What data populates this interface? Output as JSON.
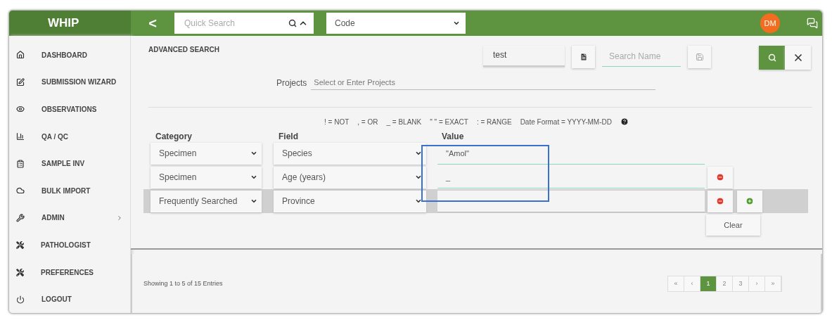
{
  "header": {
    "logo": "WHIP",
    "back": "<",
    "quick_search": {
      "placeholder": "Quick Search"
    },
    "code_select": {
      "value": "Code"
    },
    "avatar": "DM"
  },
  "sidebar": {
    "items": [
      {
        "label": "DASHBOARD",
        "kind": "home",
        "submenu": false
      },
      {
        "label": "SUBMISSION WIZARD",
        "kind": "edit",
        "submenu": false
      },
      {
        "label": "OBSERVATIONS",
        "kind": "eye",
        "submenu": false
      },
      {
        "label": "QA / QC",
        "kind": "chart",
        "submenu": false
      },
      {
        "label": "SAMPLE INV",
        "kind": "clipboard",
        "submenu": false
      },
      {
        "label": "BULK IMPORT",
        "kind": "cloud",
        "submenu": false
      },
      {
        "label": "ADMIN",
        "kind": "wrench",
        "submenu": true
      },
      {
        "label": "PATHOLOGIST",
        "kind": "tools",
        "submenu": false
      },
      {
        "label": "PREFERENCES",
        "kind": "tools",
        "submenu": false
      },
      {
        "label": "LOGOUT",
        "kind": "power",
        "submenu": false
      }
    ]
  },
  "search": {
    "title": "ADVANCED SEARCH",
    "saved_search": {
      "value": "test"
    },
    "search_name": {
      "placeholder": "Search Name"
    },
    "projects": {
      "label": "Projects",
      "placeholder": "Select or Enter Projects"
    },
    "hints": [
      "! = NOT",
      ", = OR",
      "_ = BLANK",
      "\" \" = EXACT",
      ": = RANGE",
      "Date Format = YYYY-MM-DD"
    ],
    "columns": [
      "Category",
      "Field",
      "Value"
    ],
    "rows": [
      {
        "category": "Specimen",
        "field": "Species",
        "value": "\"Amol\"",
        "removable": false,
        "addable": false,
        "highlighted": false
      },
      {
        "category": "Specimen",
        "field": "Age (years)",
        "value": "_",
        "removable": true,
        "addable": false,
        "highlighted": false
      },
      {
        "category": "Frequently Searched",
        "field": "Province",
        "removable": true,
        "addable": true,
        "highlighted": true
      }
    ],
    "clear": "Clear"
  },
  "footer": {
    "summary": "Showing 1 to 5 of 15 Entries",
    "pages": [
      {
        "label": "«",
        "selected": false
      },
      {
        "label": "‹",
        "selected": false
      },
      {
        "label": "1",
        "selected": true
      },
      {
        "label": "2",
        "selected": false
      },
      {
        "label": "3",
        "selected": false
      },
      {
        "label": "›",
        "selected": false
      },
      {
        "label": "»",
        "selected": false
      }
    ]
  }
}
